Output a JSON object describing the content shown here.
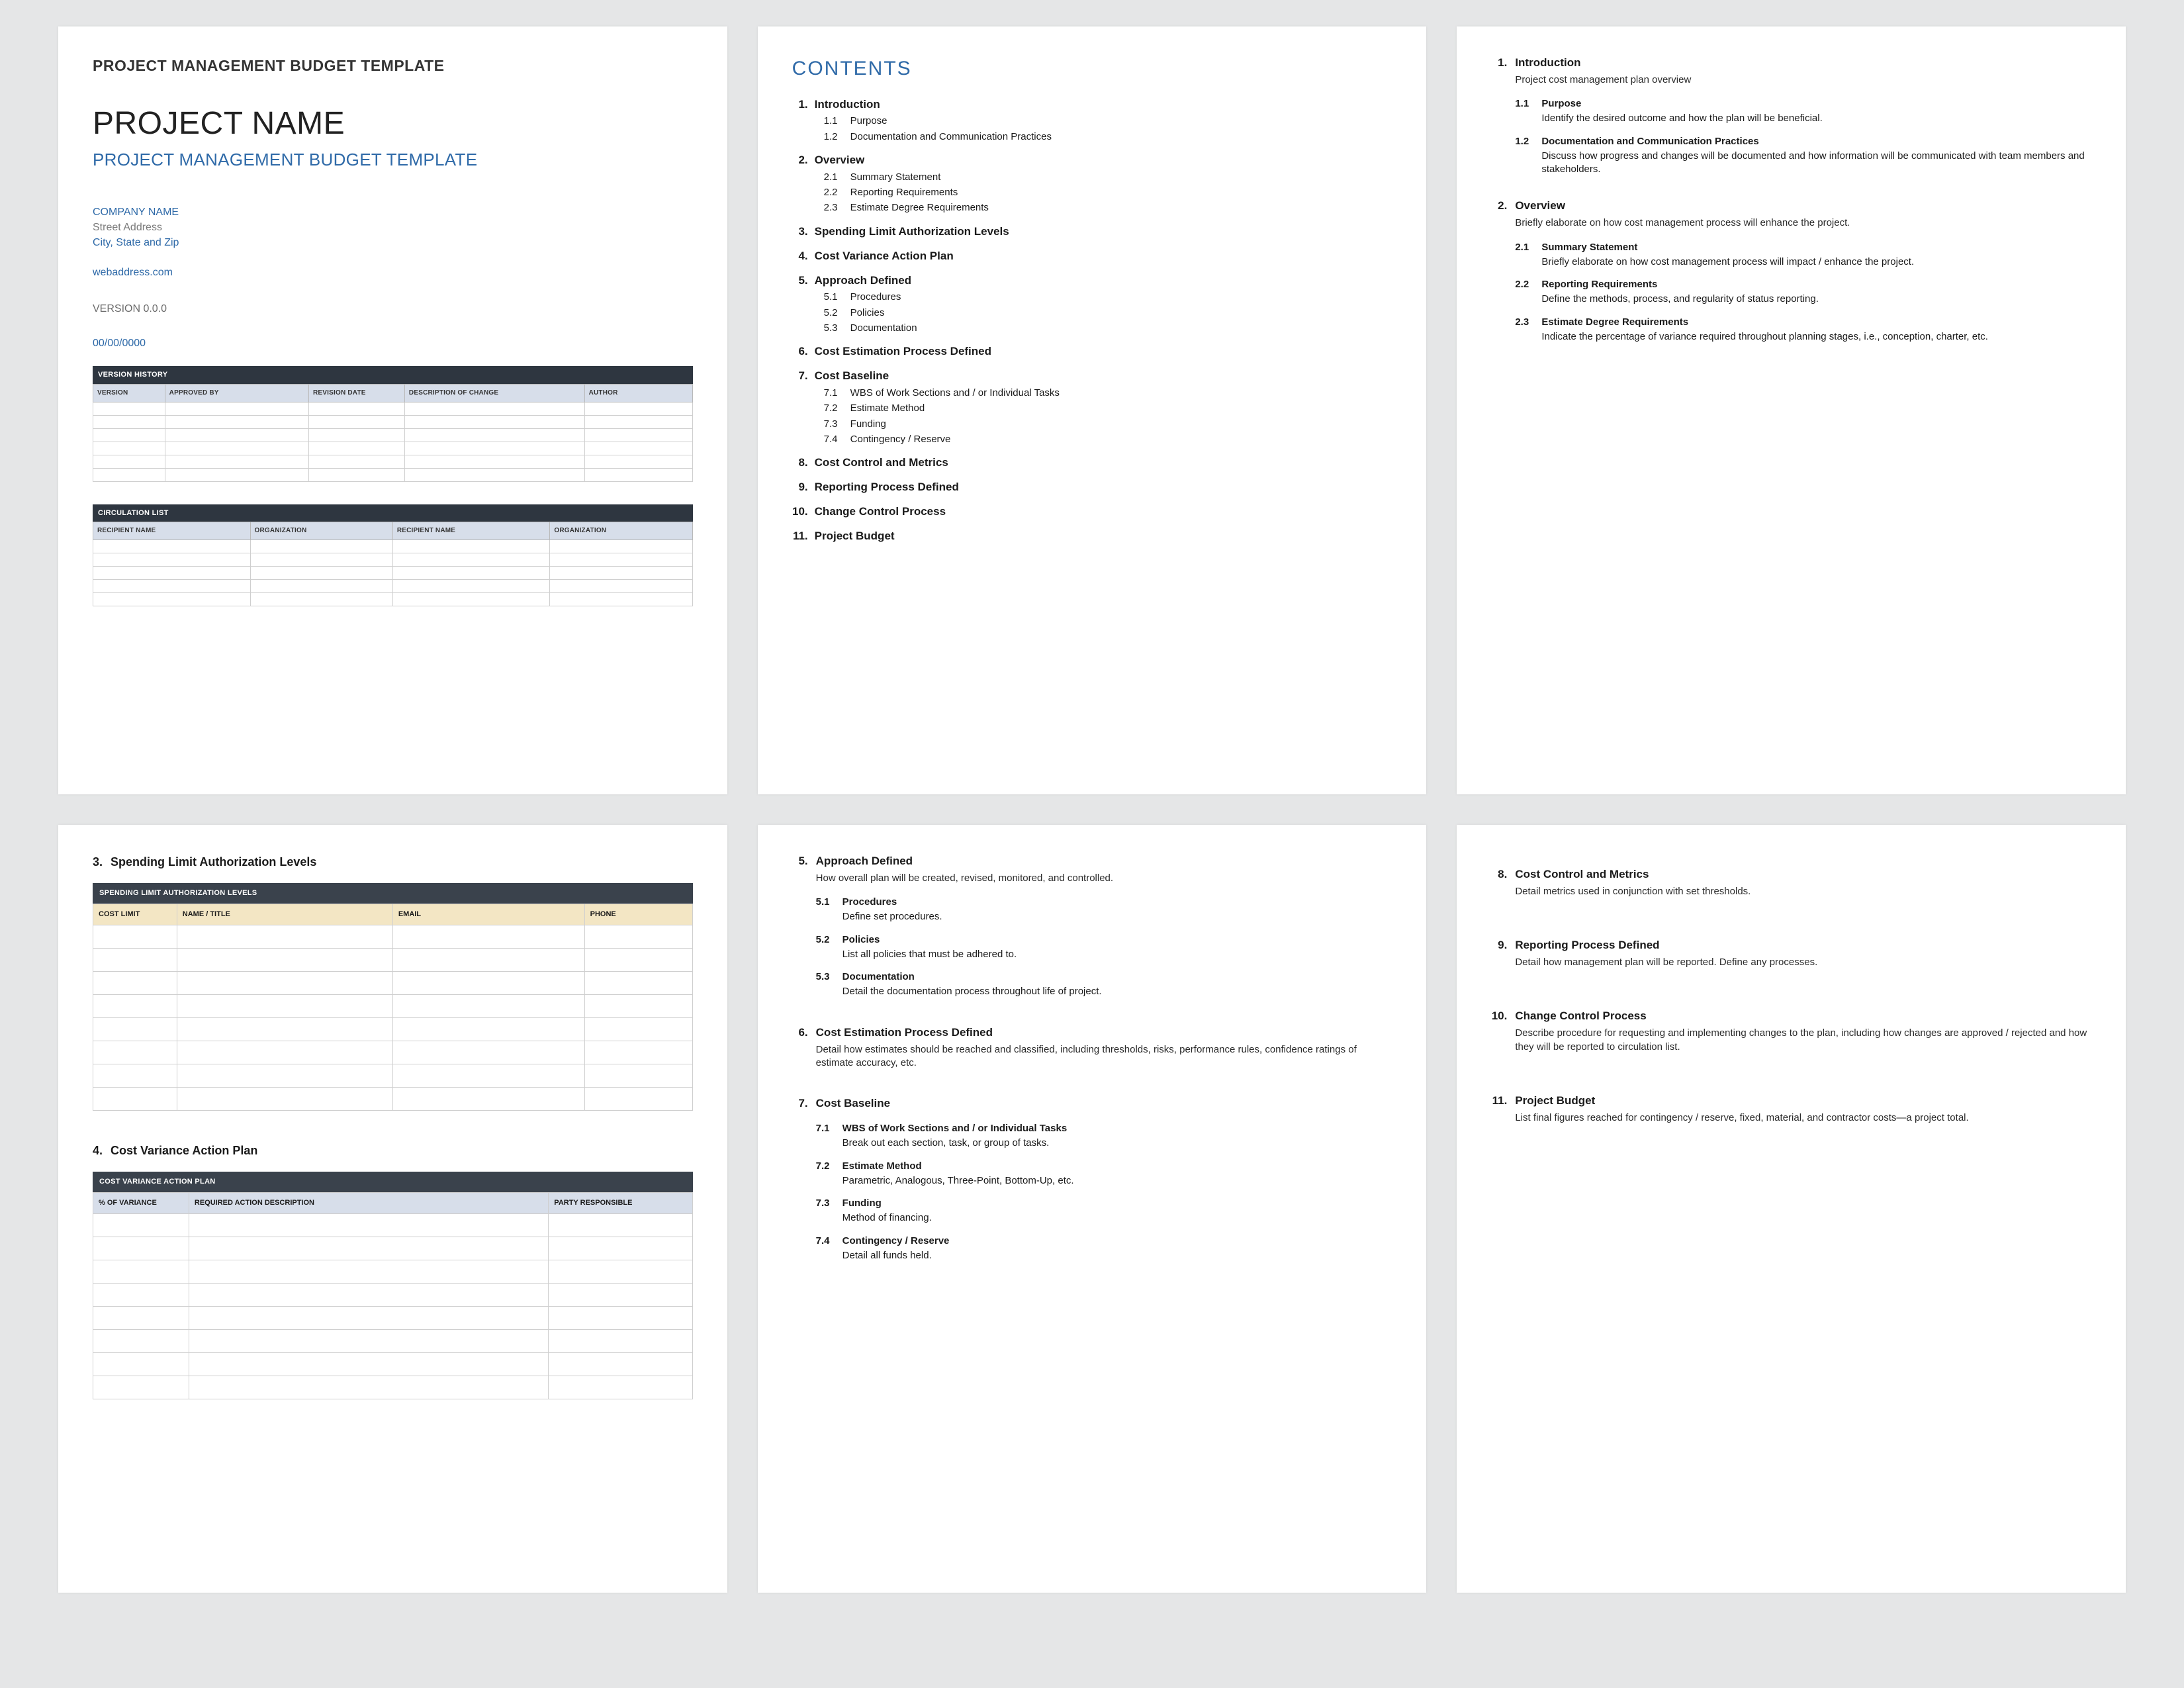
{
  "page1": {
    "kicker": "PROJECT MANAGEMENT BUDGET TEMPLATE",
    "title": "PROJECT NAME",
    "subtitle": "PROJECT MANAGEMENT BUDGET TEMPLATE",
    "company": "COMPANY NAME",
    "street": "Street Address",
    "citystate": "City, State and Zip",
    "web": "webaddress.com",
    "version": "VERSION 0.0.0",
    "date": "00/00/0000",
    "version_table": {
      "caption": "VERSION HISTORY",
      "cols": [
        "VERSION",
        "APPROVED BY",
        "REVISION DATE",
        "DESCRIPTION OF CHANGE",
        "AUTHOR"
      ],
      "rows": 6
    },
    "circulation_table": {
      "caption": "CIRCULATION LIST",
      "cols": [
        "RECIPIENT NAME",
        "ORGANIZATION",
        "RECIPIENT NAME",
        "ORGANIZATION"
      ],
      "rows": 5
    }
  },
  "contents": {
    "heading": "CONTENTS",
    "items": [
      {
        "n": "1.",
        "t": "Introduction",
        "subs": [
          {
            "n": "1.1",
            "t": "Purpose"
          },
          {
            "n": "1.2",
            "t": "Documentation and Communication Practices"
          }
        ]
      },
      {
        "n": "2.",
        "t": "Overview",
        "subs": [
          {
            "n": "2.1",
            "t": "Summary Statement"
          },
          {
            "n": "2.2",
            "t": "Reporting Requirements"
          },
          {
            "n": "2.3",
            "t": "Estimate Degree Requirements"
          }
        ]
      },
      {
        "n": "3.",
        "t": "Spending Limit Authorization Levels"
      },
      {
        "n": "4.",
        "t": "Cost Variance Action Plan"
      },
      {
        "n": "5.",
        "t": "Approach Defined",
        "subs": [
          {
            "n": "5.1",
            "t": "Procedures"
          },
          {
            "n": "5.2",
            "t": "Policies"
          },
          {
            "n": "5.3",
            "t": "Documentation"
          }
        ]
      },
      {
        "n": "6.",
        "t": "Cost Estimation Process Defined"
      },
      {
        "n": "7.",
        "t": "Cost Baseline",
        "subs": [
          {
            "n": "7.1",
            "t": "WBS of Work Sections and / or Individual Tasks"
          },
          {
            "n": "7.2",
            "t": "Estimate Method"
          },
          {
            "n": "7.3",
            "t": "Funding"
          },
          {
            "n": "7.4",
            "t": "Contingency / Reserve"
          }
        ]
      },
      {
        "n": "8.",
        "t": "Cost Control and Metrics"
      },
      {
        "n": "9.",
        "t": "Reporting Process Defined"
      },
      {
        "n": "10.",
        "t": "Change Control Process"
      },
      {
        "n": "11.",
        "t": "Project Budget"
      }
    ]
  },
  "page3": {
    "s1": {
      "n": "1.",
      "t": "Introduction",
      "d": "Project cost management plan overview",
      "subs": [
        {
          "n": "1.1",
          "t": "Purpose",
          "d": "Identify the desired outcome and how the plan will be beneficial."
        },
        {
          "n": "1.2",
          "t": "Documentation and Communication Practices",
          "d": "Discuss how progress and changes will be documented and how information will be communicated with team members and stakeholders."
        }
      ]
    },
    "s2": {
      "n": "2.",
      "t": "Overview",
      "d": "Briefly elaborate on how cost management process will enhance the project.",
      "subs": [
        {
          "n": "2.1",
          "t": "Summary Statement",
          "d": "Briefly elaborate on how cost management process will impact / enhance the project."
        },
        {
          "n": "2.2",
          "t": "Reporting Requirements",
          "d": "Define the methods, process, and regularity of status reporting."
        },
        {
          "n": "2.3",
          "t": "Estimate Degree Requirements",
          "d": "Indicate the percentage of variance required throughout planning stages, i.e., conception, charter, etc."
        }
      ]
    }
  },
  "page4": {
    "s3": {
      "n": "3.",
      "t": "Spending Limit Authorization Levels",
      "table": {
        "caption": "SPENDING LIMIT AUTHORIZATION LEVELS",
        "cols": [
          "COST LIMIT",
          "NAME / TITLE",
          "EMAIL",
          "PHONE"
        ],
        "rows": 8
      }
    },
    "s4": {
      "n": "4.",
      "t": "Cost Variance Action Plan",
      "table": {
        "caption": "COST VARIANCE ACTION PLAN",
        "cols": [
          "% OF VARIANCE",
          "REQUIRED ACTION DESCRIPTION",
          "PARTY RESPONSIBLE"
        ],
        "rows": 8
      }
    }
  },
  "page5": {
    "s5": {
      "n": "5.",
      "t": "Approach Defined",
      "d": "How overall plan will be created, revised, monitored, and controlled.",
      "subs": [
        {
          "n": "5.1",
          "t": "Procedures",
          "d": "Define set procedures."
        },
        {
          "n": "5.2",
          "t": "Policies",
          "d": "List all policies that must be adhered to."
        },
        {
          "n": "5.3",
          "t": "Documentation",
          "d": "Detail the documentation process throughout life of project."
        }
      ]
    },
    "s6": {
      "n": "6.",
      "t": "Cost Estimation Process Defined",
      "d": "Detail how estimates should be reached and classified, including thresholds, risks, performance rules, confidence ratings of estimate accuracy, etc."
    },
    "s7": {
      "n": "7.",
      "t": "Cost Baseline",
      "subs": [
        {
          "n": "7.1",
          "t": "WBS of Work Sections and / or Individual Tasks",
          "d": "Break out each section, task, or group of tasks."
        },
        {
          "n": "7.2",
          "t": "Estimate Method",
          "d": "Parametric, Analogous, Three-Point, Bottom-Up, etc."
        },
        {
          "n": "7.3",
          "t": "Funding",
          "d": "Method of financing."
        },
        {
          "n": "7.4",
          "t": "Contingency / Reserve",
          "d": "Detail all funds held."
        }
      ]
    }
  },
  "page6": {
    "s8": {
      "n": "8.",
      "t": "Cost Control and Metrics",
      "d": "Detail metrics used in conjunction with set thresholds."
    },
    "s9": {
      "n": "9.",
      "t": "Reporting Process Defined",
      "d": "Detail how management plan will be reported. Define any processes."
    },
    "s10": {
      "n": "10.",
      "t": "Change Control Process",
      "d": "Describe procedure for requesting and implementing changes to the plan, including how changes are approved / rejected and how they will be reported to circulation list."
    },
    "s11": {
      "n": "11.",
      "t": "Project Budget",
      "d": "List final figures reached for contingency / reserve, fixed, material, and contractor costs—a project total."
    }
  }
}
